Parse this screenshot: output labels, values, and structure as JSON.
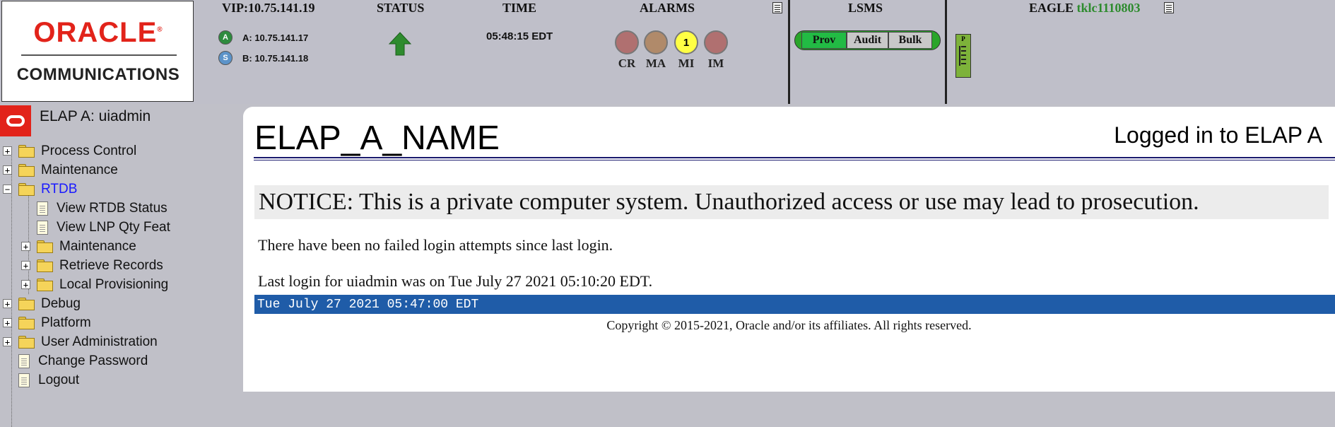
{
  "header": {
    "logo": {
      "brand": "ORACLE",
      "trademark": "®",
      "subtitle": "COMMUNICATIONS"
    },
    "vip": {
      "label": "VIP:10.75.141.19",
      "servers": [
        {
          "badge": "A",
          "text": "A: 10.75.141.17",
          "color": "#2e8b3e"
        },
        {
          "badge": "S",
          "text": "B: 10.75.141.18",
          "color": "#5c93c9"
        }
      ]
    },
    "status": {
      "label": "STATUS",
      "icon": "green-up-arrow-icon",
      "color": "#2e8b2e"
    },
    "time": {
      "label": "TIME",
      "value": "05:48:15 EDT"
    },
    "alarms": {
      "label": "ALARMS",
      "items": [
        {
          "name": "CR",
          "count": "",
          "color": "#b07070"
        },
        {
          "name": "MA",
          "count": "",
          "color": "#b08a6a"
        },
        {
          "name": "MI",
          "count": "1",
          "color": "#ffff44"
        },
        {
          "name": "IM",
          "count": "",
          "color": "#b07070"
        }
      ]
    },
    "lsms": {
      "label": "LSMS",
      "buttons": [
        "Prov",
        "Audit",
        "Bulk"
      ],
      "active": "Prov",
      "accent": "#22bb44"
    },
    "eagle": {
      "label": "EAGLE",
      "host": "tklc1110803",
      "host_color": "#2e8b2e",
      "card_label": "P"
    }
  },
  "sidebar": {
    "user": "ELAP A: uiadmin",
    "tree": [
      {
        "label": "Process Control",
        "type": "folder",
        "expander": "+",
        "level": 0
      },
      {
        "label": "Maintenance",
        "type": "folder",
        "expander": "+",
        "level": 0
      },
      {
        "label": "RTDB",
        "type": "folder",
        "expander": "−",
        "level": 0,
        "highlight": "#1a1aff"
      },
      {
        "label": "View RTDB Status",
        "type": "doc",
        "expander": "",
        "level": 1
      },
      {
        "label": "View LNP Qty Feat",
        "type": "doc",
        "expander": "",
        "level": 1
      },
      {
        "label": "Maintenance",
        "type": "folder",
        "expander": "+",
        "level": 1
      },
      {
        "label": "Retrieve Records",
        "type": "folder",
        "expander": "+",
        "level": 1
      },
      {
        "label": "Local Provisioning",
        "type": "folder",
        "expander": "+",
        "level": 1
      },
      {
        "label": "Debug",
        "type": "folder",
        "expander": "+",
        "level": 0
      },
      {
        "label": "Platform",
        "type": "folder",
        "expander": "+",
        "level": 0
      },
      {
        "label": "User Administration",
        "type": "folder",
        "expander": "+",
        "level": 0
      },
      {
        "label": "Change Password",
        "type": "doc",
        "expander": "",
        "level": 0
      },
      {
        "label": "Logout",
        "type": "doc",
        "expander": "",
        "level": 0
      }
    ]
  },
  "main": {
    "host_name": "ELAP_A_NAME",
    "logged_in": "Logged in to ELAP A",
    "notice": "NOTICE: This is a private computer system. Unauthorized access or use may lead to prosecution.",
    "failed_logins": "There have been no failed login attempts since last login.",
    "last_login": "Last login for uiadmin was on Tue July 27 2021 05:10:20 EDT.",
    "clock": "Tue July 27 2021 05:47:00 EDT",
    "copyright": "Copyright © 2015-2021, Oracle and/or its affiliates. All rights reserved."
  }
}
